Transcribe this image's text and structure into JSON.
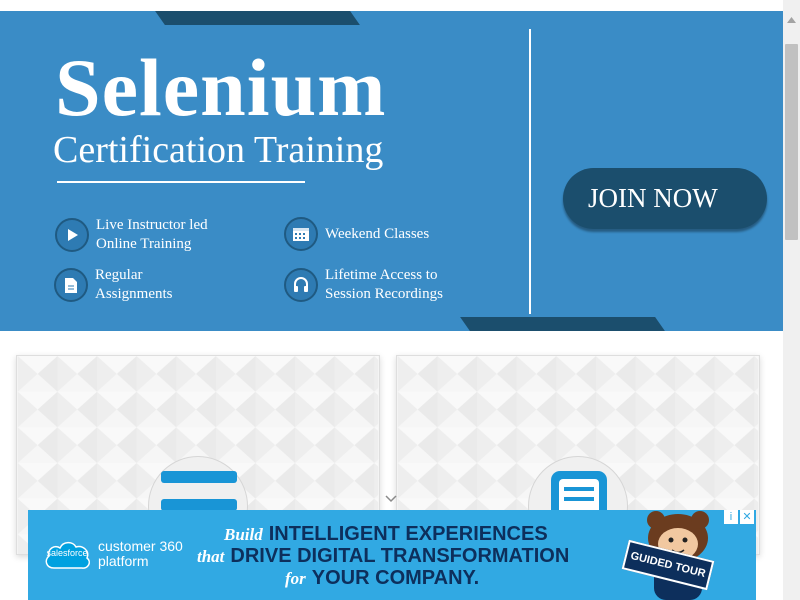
{
  "hero": {
    "title": "Selenium",
    "subtitle": "Certification Training",
    "features": [
      {
        "line1": "Live Instructor led",
        "line2": "Online Training",
        "icon": "play-icon"
      },
      {
        "line1": "Weekend Classes",
        "line2": "",
        "icon": "calendar-icon"
      },
      {
        "line1": "Regular",
        "line2": "Assignments",
        "icon": "document-icon"
      },
      {
        "line1": "Lifetime Access to",
        "line2": "Session Recordings",
        "icon": "headphones-icon"
      }
    ],
    "cta_label": "JOIN NOW",
    "colors": {
      "background": "#3a8cc6",
      "accent": "#1b4e6d"
    }
  },
  "ad": {
    "brand": "salesforce",
    "product_line1": "customer 360",
    "product_line2": "platform",
    "headline": [
      {
        "script": "Build",
        "bold": "INTELLIGENT EXPERIENCES"
      },
      {
        "script": "that",
        "bold": "DRIVE DIGITAL TRANSFORMATION"
      },
      {
        "script": "for",
        "bold": "YOUR COMPANY."
      }
    ],
    "sign": "GUIDED TOUR",
    "info_glyph": "i",
    "close_glyph": "✕",
    "colors": {
      "background": "#31a9e3",
      "text": "#0d2f5c"
    }
  }
}
